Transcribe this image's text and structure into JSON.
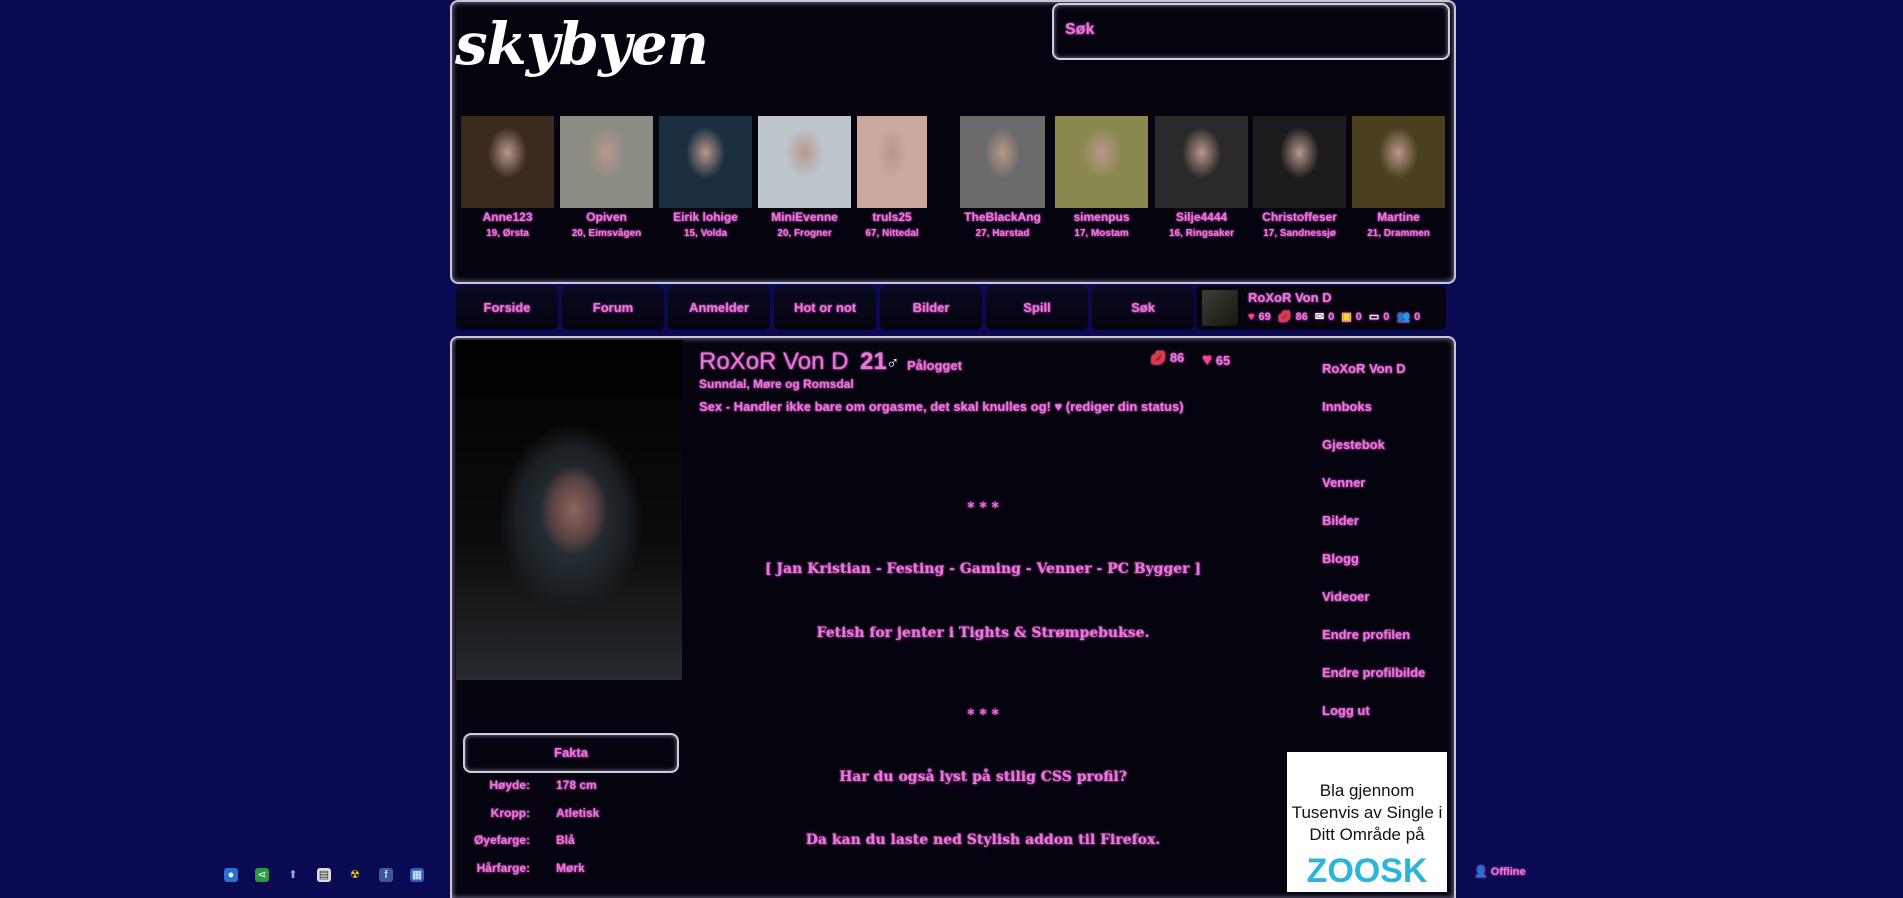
{
  "header": {
    "logo": "skybyen",
    "search_label": "Søk"
  },
  "thumbs": [
    {
      "name": "Anne123",
      "info": "19, Ørsta",
      "bg": "#3b2a1e"
    },
    {
      "name": "Opiven",
      "info": "20, Eimsvågen",
      "bg": "#8c8c84"
    },
    {
      "name": "Eirik lohige",
      "info": "15, Volda",
      "bg": "#1a3040"
    },
    {
      "name": "MiniEvenne",
      "info": "20, Frogner",
      "bg": "#bcc6cc"
    },
    {
      "name": "truls25",
      "info": "67, Nittedal",
      "bg": "#caa89c"
    },
    {
      "name": "TheBlackAng",
      "info": "27, Harstad",
      "bg": "#6a6a6a"
    },
    {
      "name": "simenpus",
      "info": "17, Mostam",
      "bg": "#8a8a50"
    },
    {
      "name": "Silje4444",
      "info": "16, Ringsaker",
      "bg": "#2a2a2a"
    },
    {
      "name": "Christoffeser",
      "info": "17, Sandnessjø",
      "bg": "#1c1c1c"
    },
    {
      "name": "Martine",
      "info": "21, Drammen",
      "bg": "#4a4020"
    }
  ],
  "nav": [
    "Forside",
    "Forum",
    "Anmelder",
    "Hot or not",
    "Bilder",
    "Spill",
    "Søk"
  ],
  "user": {
    "name": "RoXoR Von D",
    "hearts": "69",
    "lips": "86",
    "mail": "0",
    "pics": "0",
    "notes": "0",
    "friends": "0"
  },
  "profile": {
    "name": "RoXoR Von D",
    "age": "21",
    "gender_icon": "♂",
    "online": "Pålogget",
    "location": "Sunndal, Møre og Romsdal",
    "status": "Sex - Handler ikke bare om orgasme, det skal knulles og! ♥ (rediger din status)",
    "lips": "86",
    "hearts": "65"
  },
  "bio": [
    "* * *",
    "[ Jan Kristian - Festing - Gaming - Venner - PC Bygger ]",
    "Fetish for jenter i Tights & Strømpebukse.",
    "* * *",
    "Har du også lyst på stilig CSS profil?",
    "Da kan du laste ned Stylish addon til Firefox."
  ],
  "facts": {
    "header": "Fakta",
    "rows": [
      {
        "key": "Høyde:",
        "val": "178 cm"
      },
      {
        "key": "Kropp:",
        "val": "Atletisk"
      },
      {
        "key": "Øyefarge:",
        "val": "Blå"
      },
      {
        "key": "Hårfarge:",
        "val": "Mørk"
      }
    ]
  },
  "right_menu": [
    "RoXoR Von D",
    "Innboks",
    "Gjestebok",
    "Venner",
    "Bilder",
    "Blogg",
    "Videoer",
    "Endre profilen",
    "Endre profilbilde",
    "Logg ut"
  ],
  "ad": {
    "text": "Bla gjennom Tusenvis av Single i Ditt Område på",
    "logo": "ZOOSK"
  },
  "bottom": {
    "offline": "Offline"
  }
}
